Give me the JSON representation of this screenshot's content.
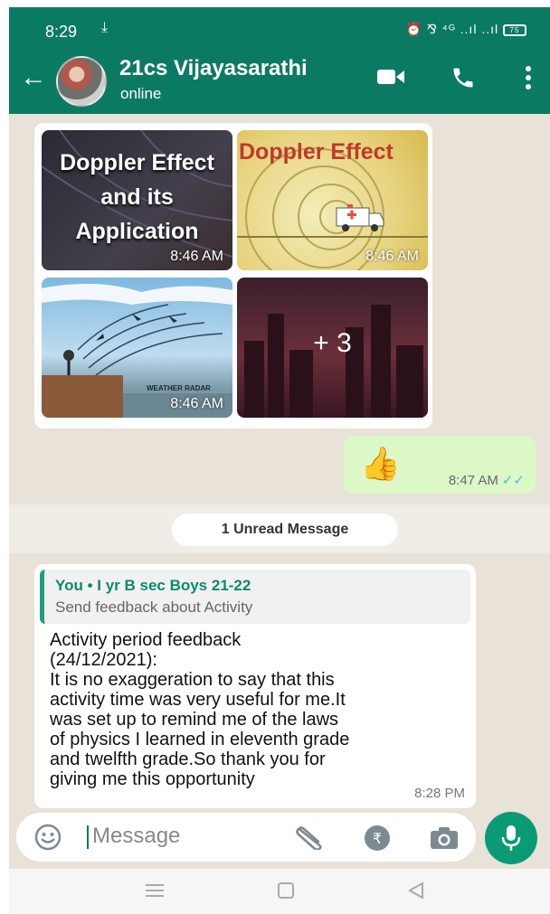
{
  "status_bar": {
    "time": "8:29",
    "download_glyph": "⤓",
    "right_icons": "⏰ ⅋ ⁴ᴳ ..ıl ..ıl",
    "battery": "75"
  },
  "header": {
    "name": "21cs Vijayasarathi",
    "status": "online",
    "back_glyph": "←"
  },
  "media": {
    "tile1": {
      "line1": "Doppler Effect",
      "line2": "and its",
      "line3": "Application",
      "time": "8:46 AM"
    },
    "tile2": {
      "title": "Doppler Effect",
      "time": "8:46 AM"
    },
    "tile3": {
      "caption": "WEATHER RADAR",
      "time": "8:46 AM"
    },
    "tile4": {
      "more": "+ 3"
    }
  },
  "outgoing": {
    "emoji": "👍",
    "time": "8:47 AM",
    "ticks": "✓✓"
  },
  "unread": "1 Unread Message",
  "incoming": {
    "quote_author": "You • I yr B sec Boys 21-22",
    "quote_text": "Send feedback about Activity",
    "lines": [
      "Activity period feedback",
      "(24/12/2021):",
      "It is no exaggeration to say that this",
      "activity time was very useful for me.It",
      "was set up to remind me of the laws",
      "of physics I learned in eleventh grade",
      "and twelfth grade.So thank you for",
      "giving me this opportunity"
    ],
    "time": "8:28 PM"
  },
  "composer": {
    "placeholder": "Message"
  },
  "colors": {
    "header": "#0b7a63",
    "outgoing_bubble": "#dcf8c6",
    "accent": "#0b9b74",
    "ticks": "#4fb6ec"
  }
}
